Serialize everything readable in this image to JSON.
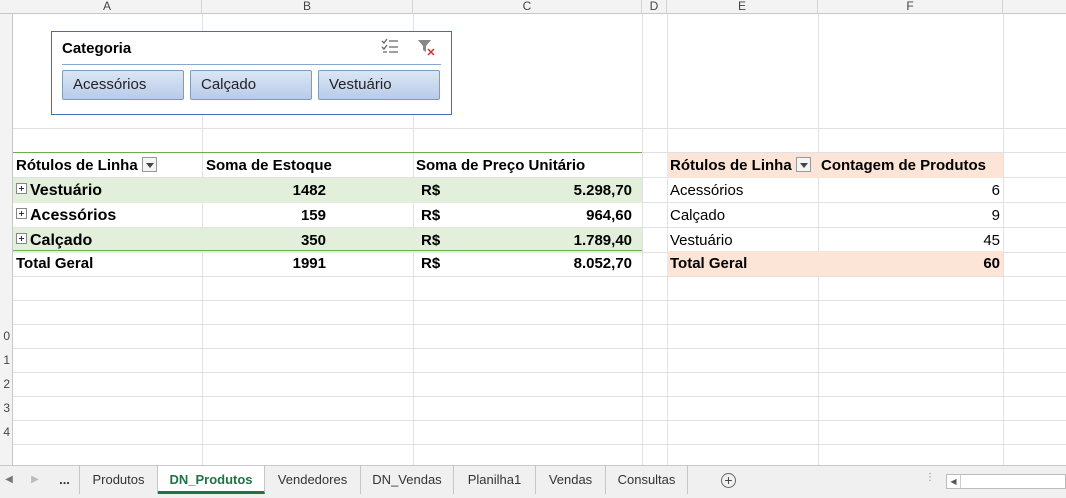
{
  "columns": [
    "A",
    "B",
    "C",
    "D",
    "E",
    "F"
  ],
  "row_numbers": [
    "0",
    "1",
    "2",
    "3",
    "4"
  ],
  "slicer": {
    "title": "Categoria",
    "items": [
      "Acessórios",
      "Calçado",
      "Vestuário"
    ],
    "multiselect_icon": "multiselect-list-icon",
    "clear_filter_icon": "clear-filter-icon"
  },
  "pivot1": {
    "headers": {
      "rows": "Rótulos de Linha",
      "stock": "Soma de Estoque",
      "price": "Soma de Preço Unitário"
    },
    "rows": [
      {
        "label": "Vestuário",
        "stock": "1482",
        "currency": "R$",
        "price": "5.298,70"
      },
      {
        "label": "Acessórios",
        "stock": "159",
        "currency": "R$",
        "price": "964,60"
      },
      {
        "label": "Calçado",
        "stock": "350",
        "currency": "R$",
        "price": "1.789,40"
      }
    ],
    "total": {
      "label": "Total Geral",
      "stock": "1991",
      "currency": "R$",
      "price": "8.052,70"
    }
  },
  "pivot2": {
    "headers": {
      "rows": "Rótulos de Linha",
      "count": "Contagem de Produtos"
    },
    "rows": [
      {
        "label": "Acessórios",
        "count": "6"
      },
      {
        "label": "Calçado",
        "count": "9"
      },
      {
        "label": "Vestuário",
        "count": "45"
      }
    ],
    "total": {
      "label": "Total Geral",
      "count": "60"
    }
  },
  "sheet_tabs": {
    "more": "...",
    "tabs": [
      "Produtos",
      "DN_Produtos",
      "Vendedores",
      "DN_Vendas",
      "Planilha1",
      "Vendas",
      "Consultas"
    ],
    "active": "DN_Produtos"
  },
  "colors": {
    "accent_green": "#217346",
    "pivot_band": "#e2efda",
    "pivot2_band": "#fce4d6",
    "slicer_border": "#3d6fb5"
  }
}
